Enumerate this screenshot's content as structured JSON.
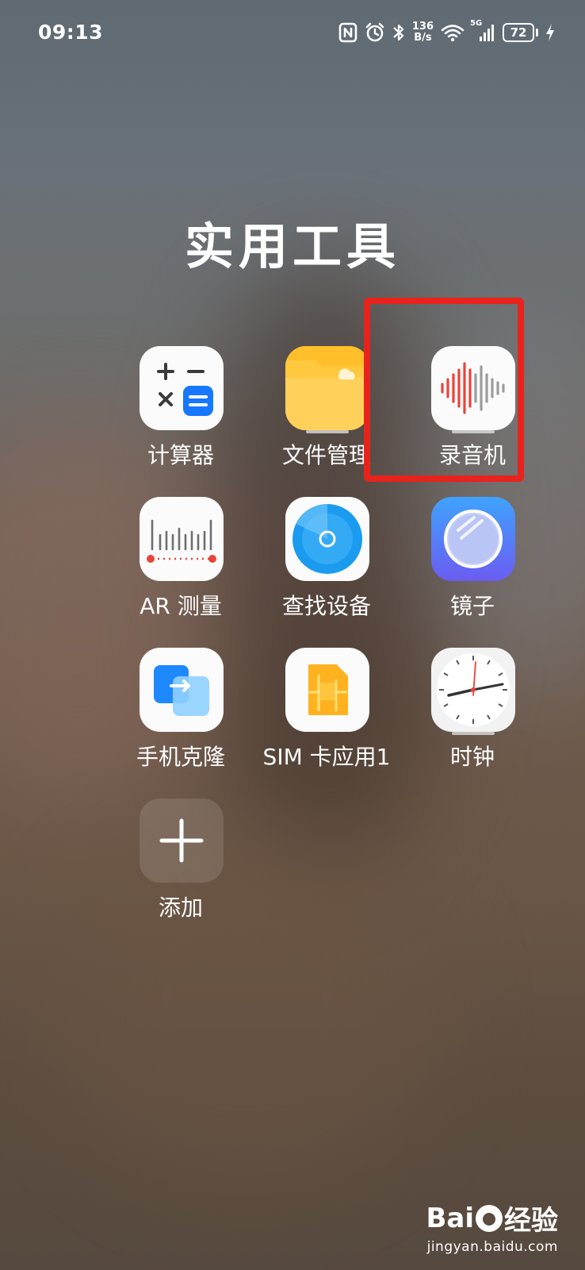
{
  "status_bar": {
    "time": "09:13",
    "net_speed_value": "136",
    "net_speed_unit": "B/s",
    "signal_type": "5G",
    "battery": "72",
    "icons": [
      "nfc-icon",
      "alarm-icon",
      "bluetooth-icon",
      "wifi-icon",
      "cellular-signal-icon",
      "battery-icon",
      "charging-icon"
    ]
  },
  "folder": {
    "title": "实用工具"
  },
  "apps": [
    {
      "label": "计算器",
      "icon": "calculator-icon"
    },
    {
      "label": "文件管理",
      "icon": "folder-icon"
    },
    {
      "label": "录音机",
      "icon": "sound-wave-icon",
      "highlighted": true
    },
    {
      "label": "AR 测量",
      "icon": "ruler-icon"
    },
    {
      "label": "查找设备",
      "icon": "radar-icon"
    },
    {
      "label": "镜子",
      "icon": "mirror-icon"
    },
    {
      "label": "手机克隆",
      "icon": "phone-clone-icon"
    },
    {
      "label": "SIM 卡应用1",
      "icon": "sim-card-icon"
    },
    {
      "label": "时钟",
      "icon": "clock-icon"
    },
    {
      "label": "添加",
      "icon": "plus-icon"
    }
  ],
  "colors": {
    "highlight_border": "#e8231d",
    "calculator_accent": "#1677ff",
    "folder_yellow": "#ffc53d",
    "recorder_red": "#e8443a",
    "finder_blue": "#1a9bf0",
    "mirror_purple": "#6b5cf0"
  },
  "watermark": {
    "brand_left": "Bai",
    "brand_right": "经验",
    "url": "jingyan.baidu.com"
  }
}
